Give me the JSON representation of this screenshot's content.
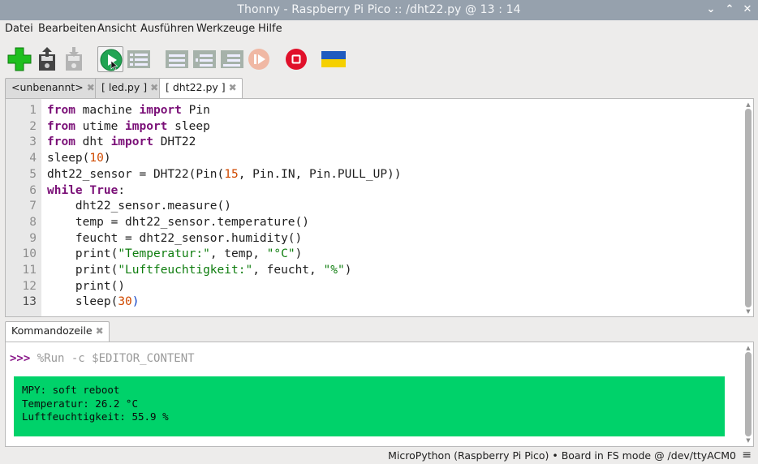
{
  "window": {
    "title": "Thonny  -  Raspberry Pi Pico :: /dht22.py  @  13 : 14",
    "controls": {
      "minimize": "⌄",
      "maximize": "⌃",
      "close": "✕"
    }
  },
  "menu": [
    "Datei",
    "Bearbeiten",
    "Ansicht",
    "Ausführen",
    "Werkzeuge",
    "Hilfe"
  ],
  "toolbar": {
    "icons": [
      "new-file-icon",
      "open-file-icon",
      "save-file-icon",
      "run-icon",
      "debug-icon",
      "step-over-icon",
      "step-into-icon",
      "step-out-icon",
      "resume-icon",
      "stop-icon",
      "ukraine-flag-icon"
    ],
    "colors": {
      "new": "#1fbf1f",
      "run": "#21a453",
      "stop": "#e0102a",
      "flag_blue": "#1f5bbf",
      "flag_yellow": "#f5d000",
      "disabled": "#a6b2aa"
    }
  },
  "tabs": [
    {
      "label": "<unbenannt>",
      "close": "✖"
    },
    {
      "label": "[ led.py ]",
      "close": "✖"
    },
    {
      "label": "[ dht22.py ]",
      "close": "✖"
    }
  ],
  "editor": {
    "line_numbers": [
      "1",
      "2",
      "3",
      "4",
      "5",
      "6",
      "7",
      "8",
      "9",
      "10",
      "11",
      "12",
      "13"
    ],
    "current_line": 13,
    "lines": [
      [
        {
          "t": "from",
          "c": "kw"
        },
        {
          "t": " machine ",
          "c": ""
        },
        {
          "t": "import",
          "c": "kw"
        },
        {
          "t": " Pin",
          "c": ""
        }
      ],
      [
        {
          "t": "from",
          "c": "kw"
        },
        {
          "t": " utime ",
          "c": ""
        },
        {
          "t": "import",
          "c": "kw"
        },
        {
          "t": " sleep",
          "c": ""
        }
      ],
      [
        {
          "t": "from",
          "c": "kw"
        },
        {
          "t": " dht ",
          "c": ""
        },
        {
          "t": "import",
          "c": "kw"
        },
        {
          "t": " DHT22",
          "c": ""
        }
      ],
      [
        {
          "t": "sleep(",
          "c": ""
        },
        {
          "t": "10",
          "c": "nm"
        },
        {
          "t": ")",
          "c": ""
        }
      ],
      [
        {
          "t": "dht22_sensor = DHT22(Pin(",
          "c": ""
        },
        {
          "t": "15",
          "c": "nm"
        },
        {
          "t": ", Pin.IN, Pin.PULL_UP))",
          "c": ""
        }
      ],
      [
        {
          "t": "while",
          "c": "kw"
        },
        {
          "t": " ",
          "c": ""
        },
        {
          "t": "True",
          "c": "kw"
        },
        {
          "t": ":",
          "c": ""
        }
      ],
      [
        {
          "t": "    dht22_sensor.measure()",
          "c": ""
        }
      ],
      [
        {
          "t": "    temp = dht22_sensor.temperature()",
          "c": ""
        }
      ],
      [
        {
          "t": "    feucht = dht22_sensor.humidity()",
          "c": ""
        }
      ],
      [
        {
          "t": "    print(",
          "c": ""
        },
        {
          "t": "\"Temperatur:\"",
          "c": "st"
        },
        {
          "t": ", temp, ",
          "c": ""
        },
        {
          "t": "\"°C\"",
          "c": "st"
        },
        {
          "t": ")",
          "c": ""
        }
      ],
      [
        {
          "t": "    print(",
          "c": ""
        },
        {
          "t": "\"Luftfeuchtigkeit:\"",
          "c": "st"
        },
        {
          "t": ", feucht, ",
          "c": ""
        },
        {
          "t": "\"%\"",
          "c": "st"
        },
        {
          "t": ")",
          "c": ""
        }
      ],
      [
        {
          "t": "    print()",
          "c": ""
        }
      ],
      [
        {
          "t": "    sleep(",
          "c": ""
        },
        {
          "t": "30",
          "c": "nm"
        },
        {
          "t": ")",
          "c": "pn"
        }
      ]
    ]
  },
  "shell": {
    "tab_label": "Kommandozeile",
    "tab_close": "✖",
    "prompt": ">>>",
    "command": " %Run -c $EDITOR_CONTENT",
    "output_lines": [
      "MPY: soft reboot",
      "Temperatur: 26.2 °C",
      "Luftfeuchtigkeit: 55.9 %"
    ],
    "output_bg": "#00d26a"
  },
  "status": {
    "text": "MicroPython (Raspberry Pi Pico)  •  Board in FS mode @ /dev/ttyACM0",
    "menu_icon": "≡"
  }
}
